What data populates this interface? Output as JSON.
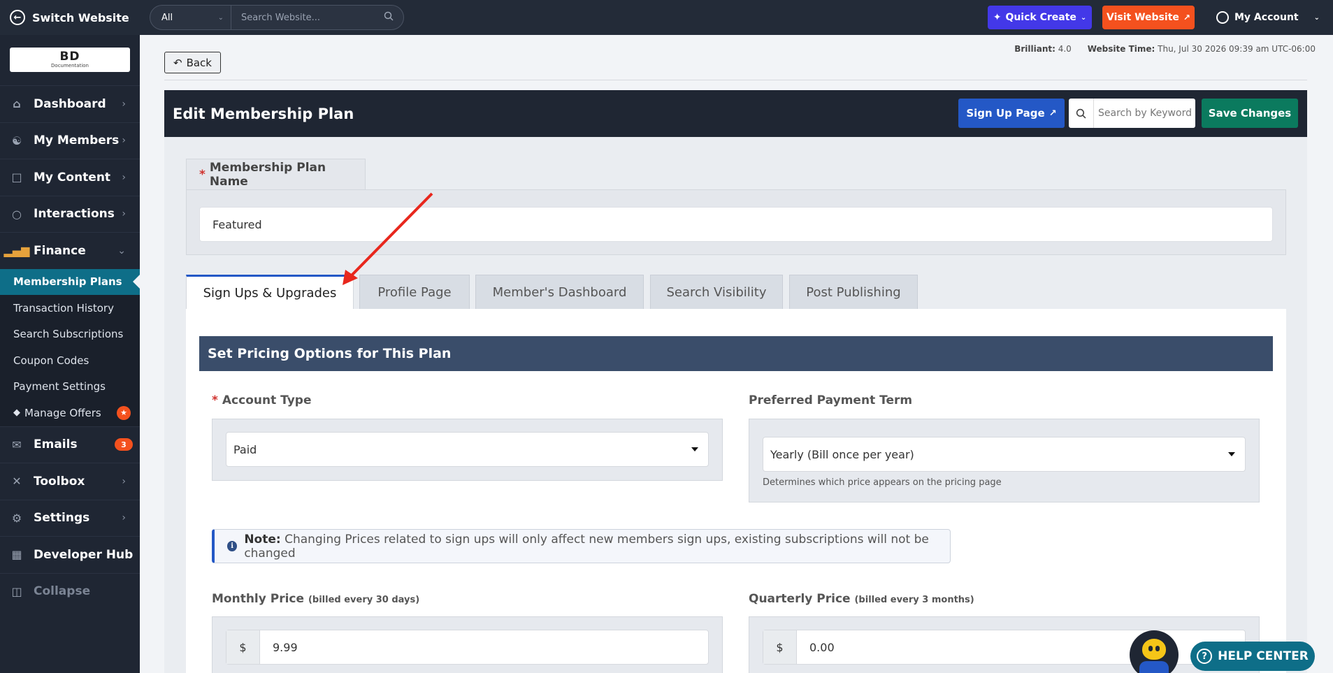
{
  "topbar": {
    "switch_website": "Switch Website",
    "scope": "All",
    "search_placeholder": "Search Website...",
    "quick_create": "Quick Create",
    "visit_website": "Visit Website",
    "my_account": "My Account"
  },
  "sidebar": {
    "logo_main": "BD",
    "logo_sub": "Documentation",
    "items": [
      {
        "label": "Dashboard",
        "icon": "home-icon"
      },
      {
        "label": "My Members",
        "icon": "users-icon"
      },
      {
        "label": "My Content",
        "icon": "folder-icon"
      },
      {
        "label": "Interactions",
        "icon": "chat-icon"
      },
      {
        "label": "Finance",
        "icon": "chart-icon"
      }
    ],
    "finance_sub": [
      {
        "label": "Membership Plans"
      },
      {
        "label": "Transaction History"
      },
      {
        "label": "Search Subscriptions"
      },
      {
        "label": "Coupon Codes"
      },
      {
        "label": "Payment Settings"
      },
      {
        "label": "Manage Offers"
      }
    ],
    "items_after": [
      {
        "label": "Emails",
        "badge": "3"
      },
      {
        "label": "Toolbox"
      },
      {
        "label": "Settings"
      },
      {
        "label": "Developer Hub"
      },
      {
        "label": "Collapse"
      }
    ]
  },
  "header": {
    "back": "Back",
    "brilliant_label": "Brilliant:",
    "brilliant_value": "4.0",
    "time_label": "Website Time:",
    "time_value": "Thu, Jul 30 2026 09:39 am UTC-06:00"
  },
  "panel": {
    "title": "Edit Membership Plan",
    "signup_page": "Sign Up Page",
    "keyword_placeholder": "Search by Keyword",
    "save_changes": "Save Changes"
  },
  "form": {
    "plan_name_label": "Membership Plan Name",
    "plan_name_value": "Featured",
    "tabs": [
      "Sign Ups & Upgrades",
      "Profile Page",
      "Member's Dashboard",
      "Search Visibility",
      "Post Publishing"
    ],
    "section_title": "Set Pricing Options for This Plan",
    "account_type_label": "Account Type",
    "account_type_value": "Paid",
    "payment_term_label": "Preferred Payment Term",
    "payment_term_value": "Yearly (Bill once per year)",
    "payment_term_help": "Determines which price appears on the pricing page",
    "note_bold": "Note:",
    "note_text": "Changing Prices related to sign ups will only affect new members sign ups, existing subscriptions will not be changed",
    "monthly_label": "Monthly Price",
    "monthly_sub": "(billed every 30 days)",
    "monthly_currency": "$",
    "monthly_value": "9.99",
    "quarterly_label": "Quarterly Price",
    "quarterly_sub": "(billed every 3 months)",
    "quarterly_currency": "$",
    "quarterly_value": "0.00"
  },
  "help_center": "HELP CENTER",
  "colors": {
    "sidebar_bg": "#1f2633",
    "active_item": "#0e6e88",
    "primary_blue": "#2458c6",
    "save_green": "#0b7a5e",
    "visit_orange": "#f4511e",
    "quick_purple": "#4338e8",
    "annotation_arrow": "#e8271d"
  }
}
